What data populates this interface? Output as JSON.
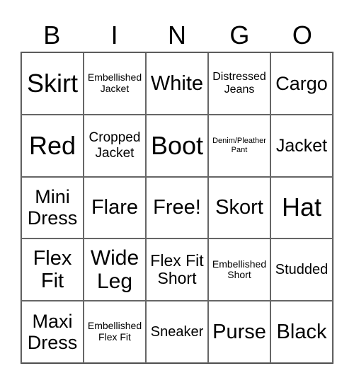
{
  "header": [
    "B",
    "I",
    "N",
    "G",
    "O"
  ],
  "cells": [
    "Skirt",
    "Embellished Jacket",
    "White",
    "Distressed Jeans",
    "Cargo",
    "Red",
    "Cropped Jacket",
    "Boot",
    "Denim/Pleather Pant",
    "Jacket",
    "Mini Dress",
    "Flare",
    "Free!",
    "Skort",
    "Hat",
    "Flex Fit",
    "Wide Leg",
    "Flex Fit Short",
    "Embellished Short",
    "Studded",
    "Maxi Dress",
    "Embellished Flex Fit",
    "Sneaker",
    "Purse",
    "Black"
  ]
}
